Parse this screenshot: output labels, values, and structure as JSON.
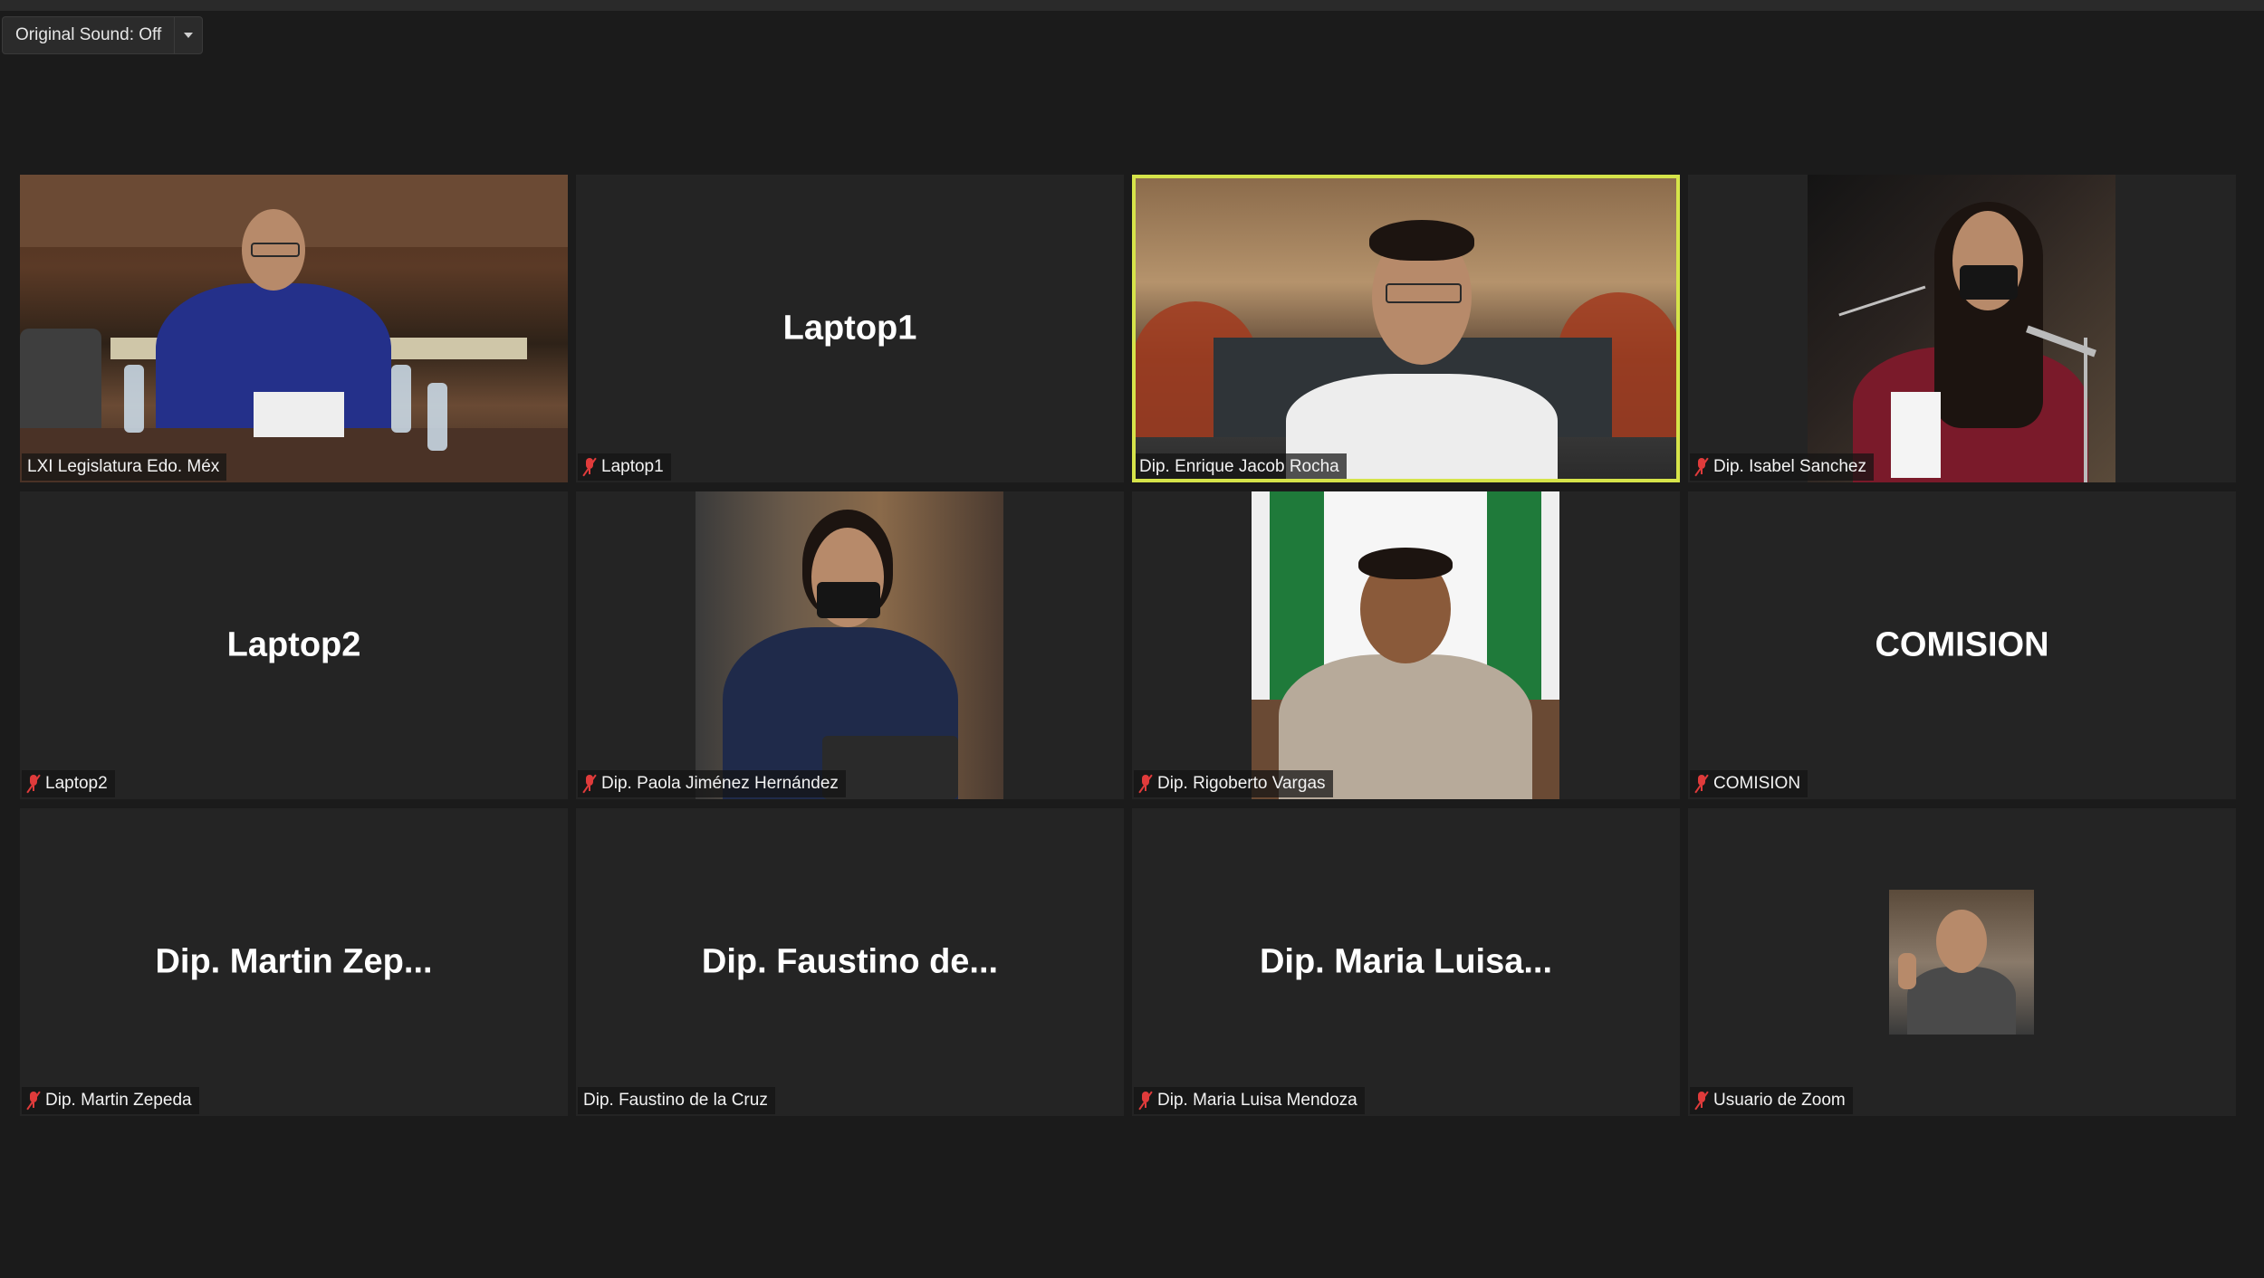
{
  "toolbar": {
    "original_sound_label": "Original Sound: Off",
    "caret_icon": "chevron-down-icon"
  },
  "colors": {
    "background": "#1b1b1b",
    "tile": "#242424",
    "active_speaker_border": "#d6e44a",
    "muted_mic": "#e03b3b"
  },
  "participants": [
    {
      "id": "p1",
      "tag": "LXI Legislatura Edo. Méx",
      "center": "",
      "muted": false,
      "video": true
    },
    {
      "id": "p2",
      "tag": "Laptop1",
      "center": "Laptop1",
      "muted": true,
      "video": false
    },
    {
      "id": "p3",
      "tag": "Dip. Enrique Jacob Rocha",
      "center": "",
      "muted": false,
      "video": true,
      "active": true
    },
    {
      "id": "p4",
      "tag": "Dip. Isabel Sanchez",
      "center": "",
      "muted": true,
      "video": true
    },
    {
      "id": "p5",
      "tag": "Laptop2",
      "center": "Laptop2",
      "muted": true,
      "video": false
    },
    {
      "id": "p6",
      "tag": "Dip. Paola Jiménez Hernández",
      "center": "",
      "muted": true,
      "video": true
    },
    {
      "id": "p7",
      "tag": "Dip. Rigoberto Vargas",
      "center": "",
      "muted": true,
      "video": true
    },
    {
      "id": "p8",
      "tag": "COMISION",
      "center": "COMISION",
      "muted": true,
      "video": false
    },
    {
      "id": "p9",
      "tag": "Dip. Martin Zepeda",
      "center": "Dip. Martin Zep...",
      "muted": true,
      "video": false
    },
    {
      "id": "p10",
      "tag": "Dip. Faustino de la Cruz",
      "center": "Dip. Faustino de...",
      "muted": false,
      "video": false
    },
    {
      "id": "p11",
      "tag": "Dip. Maria Luisa Mendoza",
      "center": "Dip. Maria Luisa...",
      "muted": true,
      "video": false
    },
    {
      "id": "p12",
      "tag": "Usuario de Zoom",
      "center": "",
      "muted": true,
      "video": true
    }
  ]
}
